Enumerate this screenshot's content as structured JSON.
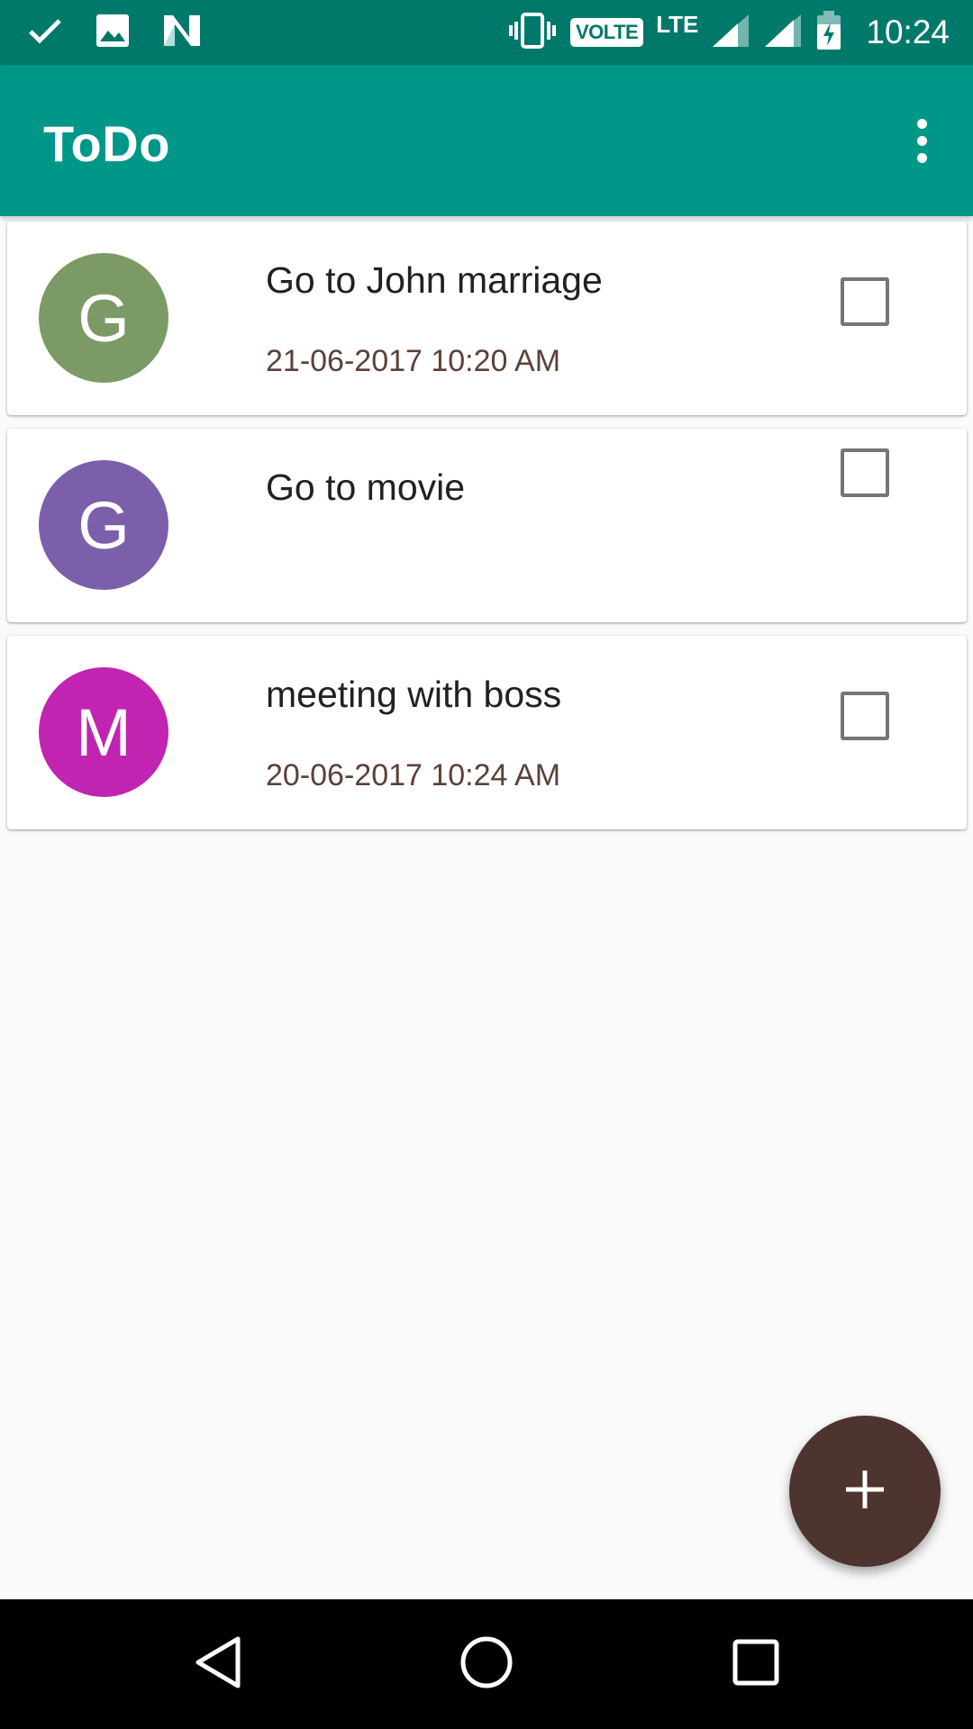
{
  "status_bar": {
    "left_icons": [
      "check-icon",
      "image-icon",
      "n-logo-icon"
    ],
    "volte_label": "VOLTE",
    "lte_label": "LTE",
    "time": "10:24",
    "colors": {
      "background": "#00796b"
    }
  },
  "app_bar": {
    "title": "ToDo",
    "menu_icon": "more-vert-icon",
    "colors": {
      "background": "#009688"
    }
  },
  "todos": [
    {
      "initial": "G",
      "title": "Go to John marriage",
      "datetime": "21-06-2017 10:20 AM",
      "avatar_color": "#7c9a65",
      "checked": false
    },
    {
      "initial": "G",
      "title": "Go to movie",
      "datetime": "",
      "avatar_color": "#7b5fab",
      "checked": false
    },
    {
      "initial": "M",
      "title": "meeting with boss",
      "datetime": "20-06-2017 10:24 AM",
      "avatar_color": "#c024b0",
      "checked": false
    }
  ],
  "fab": {
    "icon": "plus-icon",
    "color": "#4e342e"
  },
  "nav_bar": {
    "buttons": [
      "back-icon",
      "home-icon",
      "recents-icon"
    ]
  }
}
